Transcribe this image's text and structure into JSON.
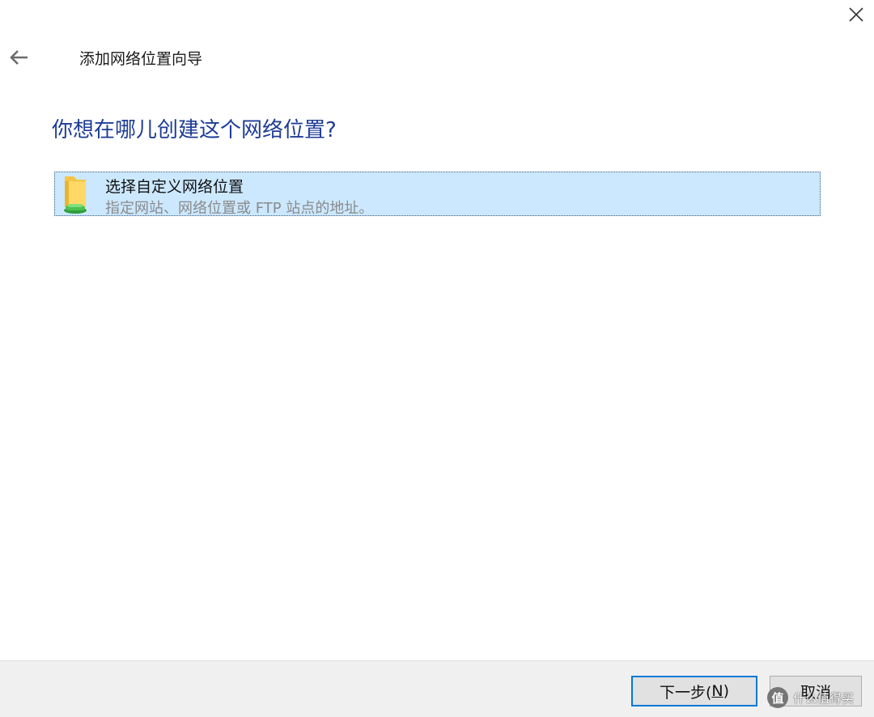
{
  "window": {
    "close_icon": "close-icon",
    "back_icon": "back-arrow-icon",
    "wizard_title": "添加网络位置向导"
  },
  "main": {
    "heading": "你想在哪儿创建这个网络位置?",
    "options": [
      {
        "icon": "network-folder-icon",
        "title": "选择自定义网络位置",
        "description": "指定网站、网络位置或 FTP 站点的地址。",
        "selected": true
      }
    ]
  },
  "footer": {
    "next_label_prefix": "下一步(",
    "next_mnemonic": "N",
    "next_label_suffix": ")",
    "cancel_label": "取消"
  },
  "watermark": {
    "logo": "值",
    "text": "什么值得买"
  },
  "colors": {
    "heading": "#1e3c96",
    "selection_bg": "#cce8ff",
    "footer_bg": "#f0f0f0",
    "default_button_border": "#0078d7"
  }
}
